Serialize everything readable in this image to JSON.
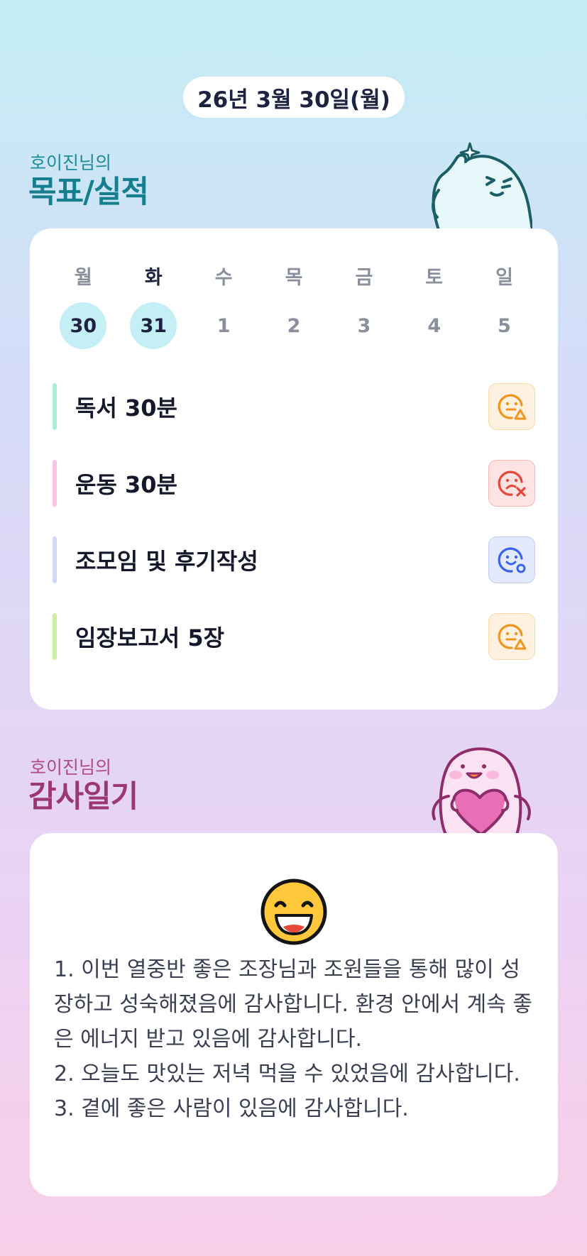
{
  "header": {
    "date": "26년 3월 30일(월)"
  },
  "goals_section": {
    "subtitle": "호이진님의",
    "title": "목표/실적",
    "week": [
      {
        "day": "월",
        "date": "30",
        "active": true
      },
      {
        "day": "화",
        "date": "31",
        "active": true,
        "today": true
      },
      {
        "day": "수",
        "date": "1"
      },
      {
        "day": "목",
        "date": "2"
      },
      {
        "day": "금",
        "date": "3"
      },
      {
        "day": "토",
        "date": "4"
      },
      {
        "day": "일",
        "date": "5"
      }
    ],
    "goals": [
      {
        "label": "독서 30분",
        "bar_color": "#a8ecd9",
        "status_icon": "smile-triangle-icon",
        "status_color": "#f0961e",
        "status_bg": "#fff1e0"
      },
      {
        "label": "운동 30분",
        "bar_color": "#fbc3df",
        "status_icon": "frown-x-icon",
        "status_color": "#e9463b",
        "status_bg": "#fde4e2"
      },
      {
        "label": "조모임 및 후기작성",
        "bar_color": "#cfd9f8",
        "status_icon": "smile-circle-icon",
        "status_color": "#3a63e6",
        "status_bg": "#e4eafd"
      },
      {
        "label": "임장보고서 5장",
        "bar_color": "#ccefa0",
        "status_icon": "smile-triangle-icon",
        "status_color": "#f0961e",
        "status_bg": "#fff1e0"
      }
    ]
  },
  "gratitude_section": {
    "subtitle": "호이진님의",
    "title": "감사일기",
    "emoji": "grinning-face-icon",
    "lines": [
      "1. 이번 열중반 좋은 조장님과 조원들을 통해 많이 성장하고 성숙해졌음에 감사합니다. 환경 안에서 계속 좋은 에너지 받고 있음에 감사합니다.",
      "2. 오늘도 맛있는 저녁 먹을 수 있었음에 감사합니다.",
      "3. 곁에 좋은 사람이 있음에 감사합니다."
    ]
  }
}
